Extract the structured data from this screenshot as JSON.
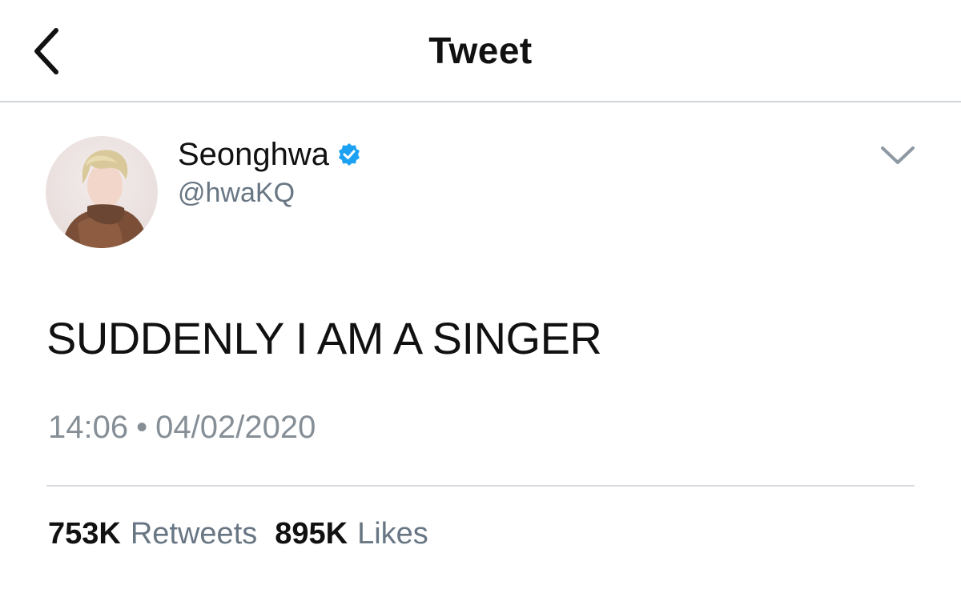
{
  "header": {
    "title": "Tweet",
    "back_icon": "chevron-left-icon"
  },
  "tweet": {
    "author": {
      "display_name": "Seonghwa",
      "handle": "@hwaKQ",
      "verified": true,
      "verified_icon": "verified-badge-icon",
      "verified_color": "#1DA1F2",
      "avatar": "avatar-photo"
    },
    "menu_icon": "chevron-down-icon",
    "text": "SUDDENLY I AM A SINGER",
    "time": "14:06",
    "separator": "•",
    "date": "04/02/2020",
    "stats": {
      "retweets_count": "753K",
      "retweets_label": "Retweets",
      "likes_count": "895K",
      "likes_label": "Likes"
    }
  }
}
